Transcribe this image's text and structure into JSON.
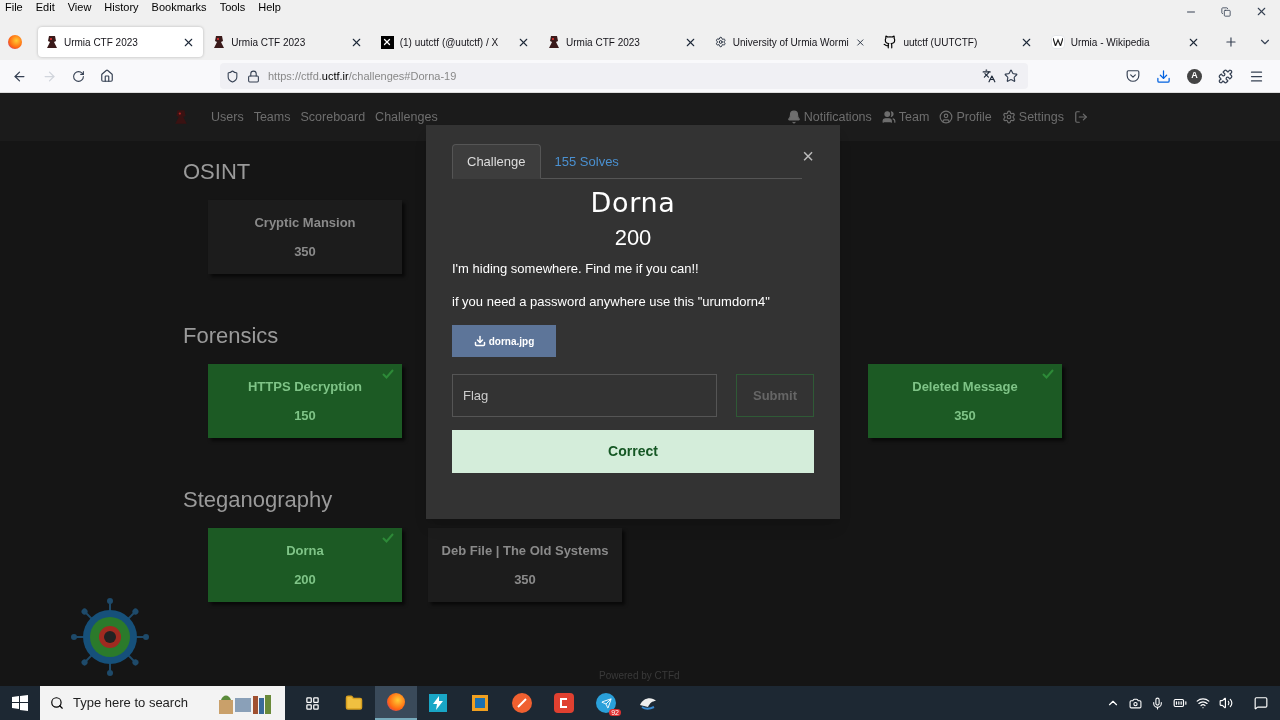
{
  "menu_bar": [
    "File",
    "Edit",
    "View",
    "History",
    "Bookmarks",
    "Tools",
    "Help"
  ],
  "tabs": [
    {
      "title": "Urmia CTF 2023",
      "kind": "ctf",
      "selected": true
    },
    {
      "title": "Urmia CTF 2023",
      "kind": "ctf",
      "selected": false
    },
    {
      "title": "(1) uutctf (@uutctf) / X",
      "kind": "x",
      "selected": false
    },
    {
      "title": "Urmia CTF 2023",
      "kind": "ctf",
      "selected": false
    },
    {
      "title": "University of Urmia Wormi",
      "kind": "gear",
      "selected": false
    },
    {
      "title": "uutctf (UUTCTF)",
      "kind": "github",
      "selected": false
    },
    {
      "title": "Urmia - Wikipedia",
      "kind": "wiki",
      "selected": false
    }
  ],
  "address_bar": {
    "url_prefix": "https://ctfd.",
    "url_domain": "uctf.ir",
    "url_path": "/challenges#Dorna-19",
    "account_initial": "A"
  },
  "navbar": {
    "left": [
      "Users",
      "Teams",
      "Scoreboard",
      "Challenges"
    ],
    "right": [
      {
        "label": "Notifications",
        "kind": "bell"
      },
      {
        "label": "Team",
        "kind": "users"
      },
      {
        "label": "Profile",
        "kind": "user"
      },
      {
        "label": "Settings",
        "kind": "gears"
      }
    ]
  },
  "sections": [
    {
      "title": "OSINT",
      "cards": [
        {
          "name": "Cryptic Mansion",
          "points": "350",
          "solved": false
        }
      ]
    },
    {
      "title": "Forensics",
      "cards": [
        {
          "name": "HTTPS Decryption",
          "points": "150",
          "solved": true
        },
        {
          "name": "Deleted Message",
          "points": "350",
          "solved": true
        }
      ]
    },
    {
      "title": "Steganography",
      "cards": [
        {
          "name": "Dorna",
          "points": "200",
          "solved": true
        },
        {
          "name": "Deb File | The Old Systems",
          "points": "350",
          "solved": false
        }
      ]
    }
  ],
  "footer": "Powered by CTFd",
  "dialog": {
    "tabs": [
      {
        "label": "Challenge",
        "selected": true
      },
      {
        "label": "155 Solves",
        "selected": false
      }
    ],
    "close": "×",
    "name": "Dorna",
    "value": "200",
    "description": [
      "I'm hiding somewhere. Find me if you can!!",
      "if you need a password anywhere use this \"urumdorn4\""
    ],
    "file": "dorna.jpg",
    "flag_placeholder": "Flag",
    "submit": "Submit",
    "result": {
      "message": "Correct",
      "correct": true
    }
  },
  "taskbar": {
    "search_placeholder": "Type here to search",
    "telegram_badge": "92"
  }
}
